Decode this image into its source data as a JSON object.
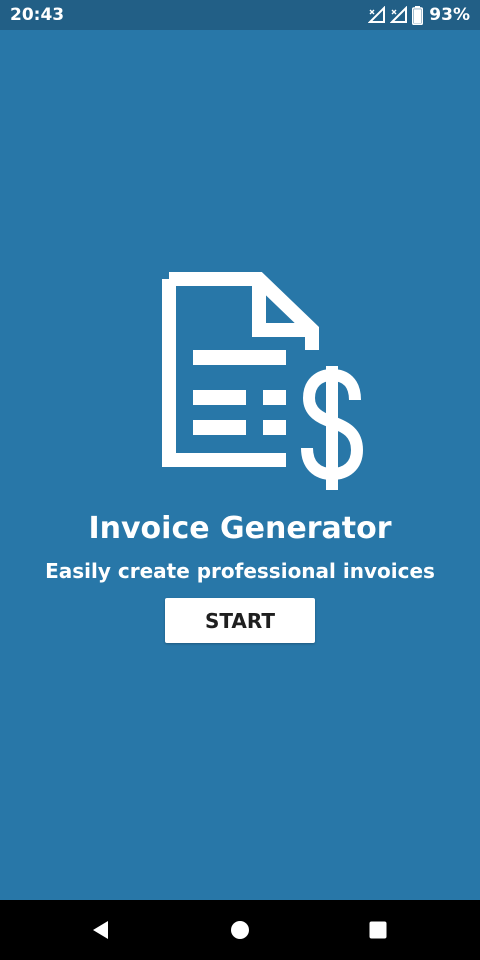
{
  "status_bar": {
    "time": "20:43",
    "battery_percent": "93%",
    "icons": [
      "signal-no-data-icon",
      "signal-icon",
      "battery-icon"
    ]
  },
  "main": {
    "logo_icon": "invoice-dollar-icon",
    "title": "Invoice Generator",
    "subtitle": "Easily create professional invoices",
    "start_label": "START"
  },
  "nav_bar": {
    "icons": [
      "back-icon",
      "home-icon",
      "recents-icon"
    ]
  },
  "colors": {
    "background": "#2877a8",
    "status_bar": "#225f86",
    "button": "#ffffff",
    "nav_bar": "#000000"
  }
}
